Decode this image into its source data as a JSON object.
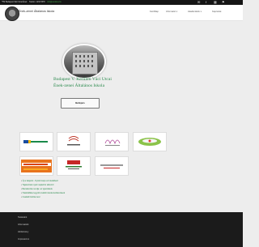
{
  "topbar": {
    "school": "*TM Budapest Váci Utcai Ének",
    "mid": "Telefon: 1234 5678",
    "email": "info@vaciutca.hu"
  },
  "header": {
    "site_name": "Ének-zenei Általános Iskola",
    "nav": [
      "Kezdőlap",
      "Információ ▾",
      "Akadémiáink ▾",
      "Kapcsolat"
    ],
    "icons": [
      "mail-icon",
      "facebook-icon",
      "calendar-icon",
      "flag-icon"
    ]
  },
  "hero": {
    "title_line1": "Budapest V. Kerületi Váci Utcai",
    "title_line2": "Ének-zenei Általános Iskola",
    "button": "Belépés"
  },
  "cards": [
    {
      "name": "card-erasmus-plus"
    },
    {
      "name": "card-program-2"
    },
    {
      "name": "card-program-3"
    },
    {
      "name": "card-program-4"
    },
    {
      "name": "card-digitalis"
    },
    {
      "name": "card-program-6"
    },
    {
      "name": "card-program-7"
    }
  ],
  "links": [
    "Új a tiétjeink - Nyitott kapu az iskolában!",
    "Tájékoztató nyári napközis táborról",
    "Beiratkozás rendje: az igazolások",
    "Határidőkkel együtt további iskolai korlátozások",
    "Családi fotózás lesz"
  ],
  "footer": {
    "items": [
      "Tanáraink",
      "Információk",
      "Hirdetmény",
      "Impresszum"
    ]
  },
  "colors": {
    "accent": "#2b8a4d",
    "footer_bg": "#1b1b1b",
    "topbar_bg": "#151515"
  }
}
